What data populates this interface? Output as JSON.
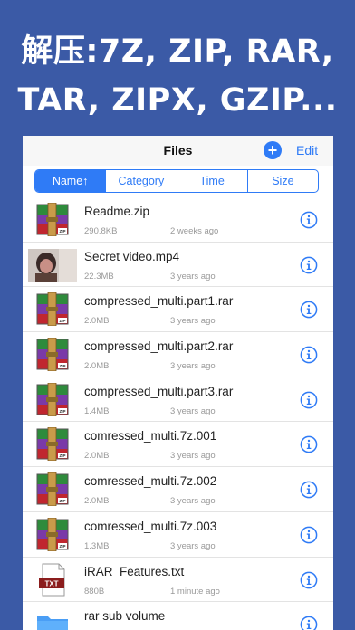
{
  "headline": {
    "line1": "解压:7Z, ZIP, RAR,",
    "line2": "TAR, ZIPX, GZIP..."
  },
  "navbar": {
    "title": "Files",
    "add_label": "+",
    "edit_label": "Edit"
  },
  "sort_tabs": [
    {
      "label": "Name↑",
      "active": true
    },
    {
      "label": "Category",
      "active": false
    },
    {
      "label": "Time",
      "active": false
    },
    {
      "label": "Size",
      "active": false
    }
  ],
  "colors": {
    "background": "#3b5aa6",
    "accent": "#2f7bf6"
  },
  "files": [
    {
      "name": "Readme.zip",
      "size": "290.8KB",
      "time": "2 weeks ago",
      "icon": "rar-archive-icon"
    },
    {
      "name": "Secret video.mp4",
      "size": "22.3MB",
      "time": "3 years ago",
      "icon": "video-thumbnail"
    },
    {
      "name": "compressed_multi.part1.rar",
      "size": "2.0MB",
      "time": "3 years ago",
      "icon": "rar-archive-icon"
    },
    {
      "name": "compressed_multi.part2.rar",
      "size": "2.0MB",
      "time": "3 years ago",
      "icon": "rar-archive-icon"
    },
    {
      "name": "compressed_multi.part3.rar",
      "size": "1.4MB",
      "time": "3 years ago",
      "icon": "rar-archive-icon"
    },
    {
      "name": "comressed_multi.7z.001",
      "size": "2.0MB",
      "time": "3 years ago",
      "icon": "rar-archive-icon"
    },
    {
      "name": "comressed_multi.7z.002",
      "size": "2.0MB",
      "time": "3 years ago",
      "icon": "rar-archive-icon"
    },
    {
      "name": "comressed_multi.7z.003",
      "size": "1.3MB",
      "time": "3 years ago",
      "icon": "rar-archive-icon"
    },
    {
      "name": "iRAR_Features.txt",
      "size": "880B",
      "time": "1 minute ago",
      "icon": "txt-file-icon"
    },
    {
      "name": "rar sub volume",
      "size": "",
      "time": "",
      "icon": "folder-icon"
    }
  ]
}
